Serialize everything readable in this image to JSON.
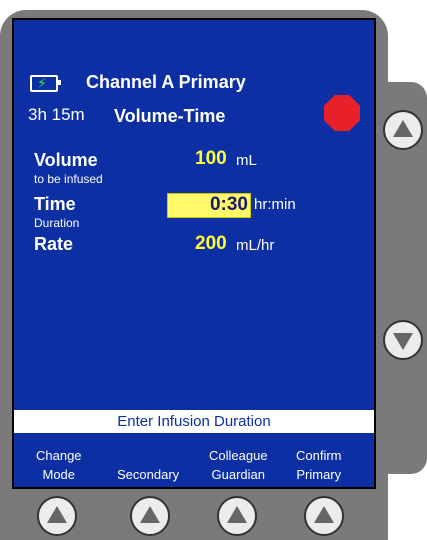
{
  "header": {
    "channel_title": "Channel A Primary",
    "battery_remaining": "3h 15m",
    "mode": "Volume-Time"
  },
  "fields": [
    {
      "label": "Volume",
      "sublabel": "to be infused",
      "value": "100",
      "unit": "mL"
    },
    {
      "label": "Time",
      "sublabel": "Duration",
      "value": "0:30",
      "unit": "hr:min"
    },
    {
      "label": "Rate",
      "sublabel": "",
      "value": "200",
      "unit": "mL/hr"
    }
  ],
  "prompt": "Enter Infusion Duration",
  "softkeys": [
    {
      "line1": "Change",
      "line2": "Mode"
    },
    {
      "line1": "",
      "line2": "Secondary"
    },
    {
      "line1": "Colleague",
      "line2": "Guardian"
    },
    {
      "line1": "Confirm",
      "line2": "Primary"
    }
  ],
  "icons": {
    "battery": "battery-charging-icon",
    "stop": "stop-icon",
    "scroll_up": "up-arrow-icon",
    "scroll_down": "down-arrow-icon",
    "softkey_button": "up-arrow-icon"
  },
  "colors": {
    "screen_bg": "#0c2fa3",
    "value_text": "#ffff38",
    "highlight_bg": "#fff96a",
    "stop": "#e8202a",
    "battery_bolt": "#35e04a",
    "bezel": "#7a7a7a"
  }
}
